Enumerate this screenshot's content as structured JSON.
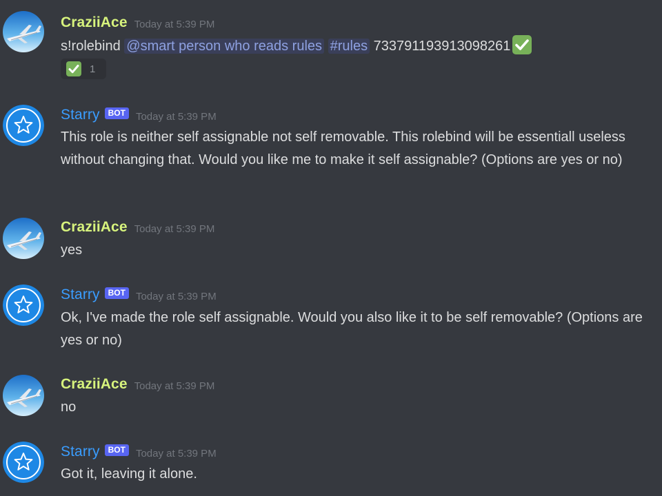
{
  "messages": [
    {
      "author": "CraziiAce",
      "timestamp": "Today at 5:39 PM",
      "parts": {
        "prefix": "s!rolebind",
        "role_mention": "@smart person who reads rules",
        "channel_mention": "#rules",
        "id_text": "733791193913098261"
      },
      "reaction": {
        "emoji": "white-check-mark",
        "count": "1"
      }
    },
    {
      "author": "Starry",
      "bot_tag": "BOT",
      "timestamp": "Today at 5:39 PM",
      "text": "This role is neither self assignable not self removable. This rolebind will be essentiall useless without changing that. Would you like me to make it self assignable? (Options are yes or no)"
    },
    {
      "author": "CraziiAce",
      "timestamp": "Today at 5:39 PM",
      "text": "yes"
    },
    {
      "author": "Starry",
      "bot_tag": "BOT",
      "timestamp": "Today at 5:39 PM",
      "text": "Ok, I've made the role self assignable. Would you also like it to be self removable? (Options are yes or no)"
    },
    {
      "author": "CraziiAce",
      "timestamp": "Today at 5:39 PM",
      "text": "no"
    },
    {
      "author": "Starry",
      "bot_tag": "BOT",
      "timestamp": "Today at 5:39 PM",
      "text": "Got it, leaving it alone."
    }
  ],
  "colors": {
    "background": "#36393f",
    "crazii_name": "#d7f37d",
    "starry_name": "#3a9dff",
    "bot_tag": "#5865f2",
    "mention": "#8ea1e1",
    "check_emoji": "#78b159"
  },
  "icons": {
    "crazii_avatar": "airplane-icon",
    "starry_avatar": "star-icon"
  }
}
